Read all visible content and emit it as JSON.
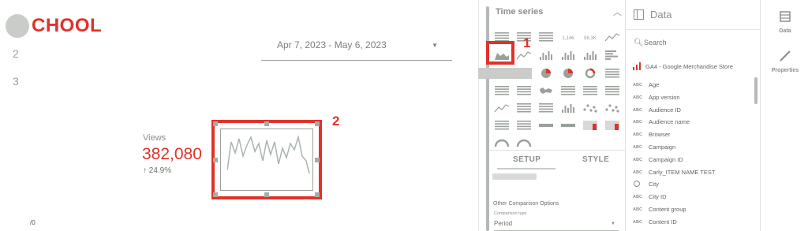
{
  "report": {
    "logo_text": "CHOOL",
    "nav_numbers": [
      "2",
      "3"
    ],
    "footer_text": "/0",
    "date_range": "Apr 7, 2023 - May 6, 2023",
    "kpi": {
      "label": "Views",
      "value": "382,080",
      "delta": "24.9%"
    }
  },
  "annotations": {
    "badge_1": "1",
    "badge_2": "2"
  },
  "chart_panel": {
    "title": "Time series",
    "icon_label_1": "1,146",
    "icon_label_2": "88.3K",
    "tabs": [
      "SETUP",
      "STYLE"
    ],
    "other_options_heading": "Other Comparison Options",
    "comparison_type_label": "Comparison type",
    "comparison_type_value": "Period"
  },
  "data_panel": {
    "title": "Data",
    "search_placeholder": "Search",
    "source_name": "GA4 - Google Merchandise Store",
    "fields": [
      {
        "type": "ABC",
        "name": "Age"
      },
      {
        "type": "ABC",
        "name": "App version"
      },
      {
        "type": "ABC",
        "name": "Audience ID"
      },
      {
        "type": "ABC",
        "name": "Audience name"
      },
      {
        "type": "ABC",
        "name": "Browser"
      },
      {
        "type": "ABC",
        "name": "Campaign"
      },
      {
        "type": "ABC",
        "name": "Campaign ID"
      },
      {
        "type": "ABC",
        "name": "Carly_ITEM NAME TEST"
      },
      {
        "type": "globe",
        "name": "City"
      },
      {
        "type": "ABC",
        "name": "City ID"
      },
      {
        "type": "ABC",
        "name": "Content group"
      },
      {
        "type": "ABC",
        "name": "Content ID"
      }
    ]
  },
  "right_rail": [
    {
      "label": "Data",
      "icon": "table-icon"
    },
    {
      "label": "Properties",
      "icon": "pencil-icon"
    }
  ],
  "colors": {
    "accent": "#e0322a",
    "muted": "#8a908a"
  }
}
